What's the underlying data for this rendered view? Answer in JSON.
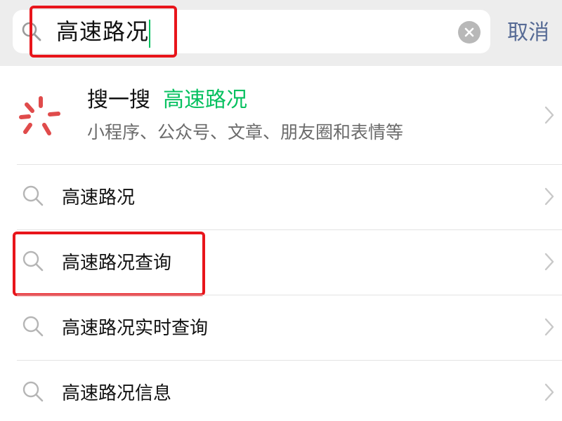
{
  "search": {
    "query": "高速路况",
    "cancel_label": "取消"
  },
  "sousou": {
    "title": "搜一搜",
    "keyword": "高速路况",
    "subtitle": "小程序、公众号、文章、朋友圈和表情等"
  },
  "suggestions": [
    {
      "label": "高速路况"
    },
    {
      "label": "高速路况查询"
    },
    {
      "label": "高速路况实时查询"
    },
    {
      "label": "高速路况信息"
    }
  ],
  "colors": {
    "accent_green": "#07c160",
    "link_blue": "#576b95",
    "highlight_red": "#e8151b",
    "sousou_icon": "#e04b4b"
  },
  "icons": {
    "search": "search-icon",
    "clear": "clear-icon",
    "sousou": "sousou-icon",
    "chevron": "chevron-right-icon"
  }
}
